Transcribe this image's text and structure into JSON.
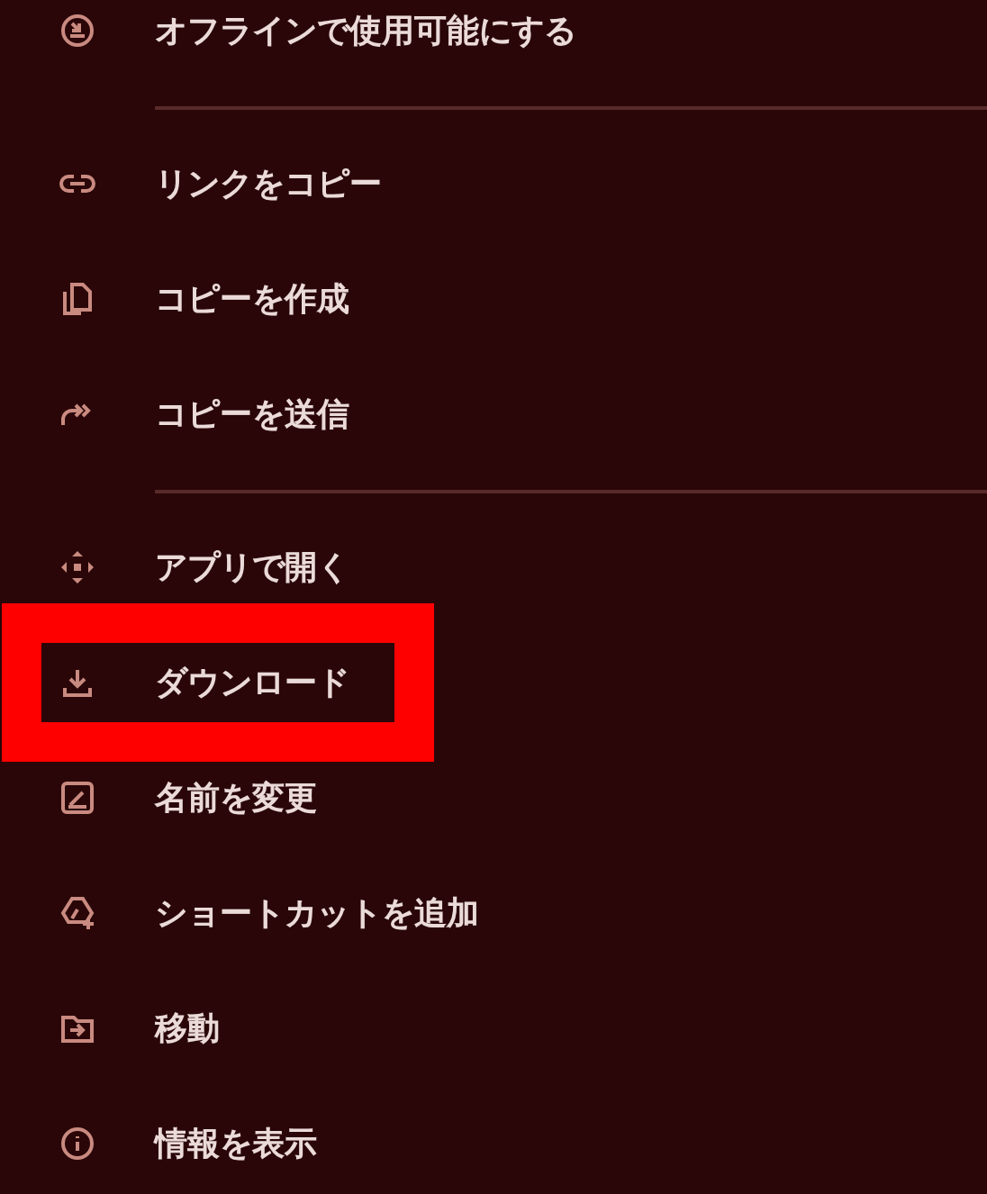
{
  "menu": {
    "groups": [
      {
        "items": [
          {
            "label": "オフラインで使用可能にする",
            "kind": "offline",
            "highlighted": false
          }
        ]
      },
      {
        "items": [
          {
            "label": "リンクをコピー",
            "kind": "link",
            "highlighted": false
          },
          {
            "label": "コピーを作成",
            "kind": "copy",
            "highlighted": false
          },
          {
            "label": "コピーを送信",
            "kind": "send",
            "highlighted": false
          }
        ]
      },
      {
        "items": [
          {
            "label": "アプリで開く",
            "kind": "apps",
            "highlighted": false
          },
          {
            "label": "ダウンロード",
            "kind": "download",
            "highlighted": true
          },
          {
            "label": "名前を変更",
            "kind": "rename",
            "highlighted": false
          },
          {
            "label": "ショートカットを追加",
            "kind": "shortcut",
            "highlighted": false
          },
          {
            "label": "移動",
            "kind": "move",
            "highlighted": false
          },
          {
            "label": "情報を表示",
            "kind": "info",
            "highlighted": false
          }
        ]
      }
    ]
  }
}
